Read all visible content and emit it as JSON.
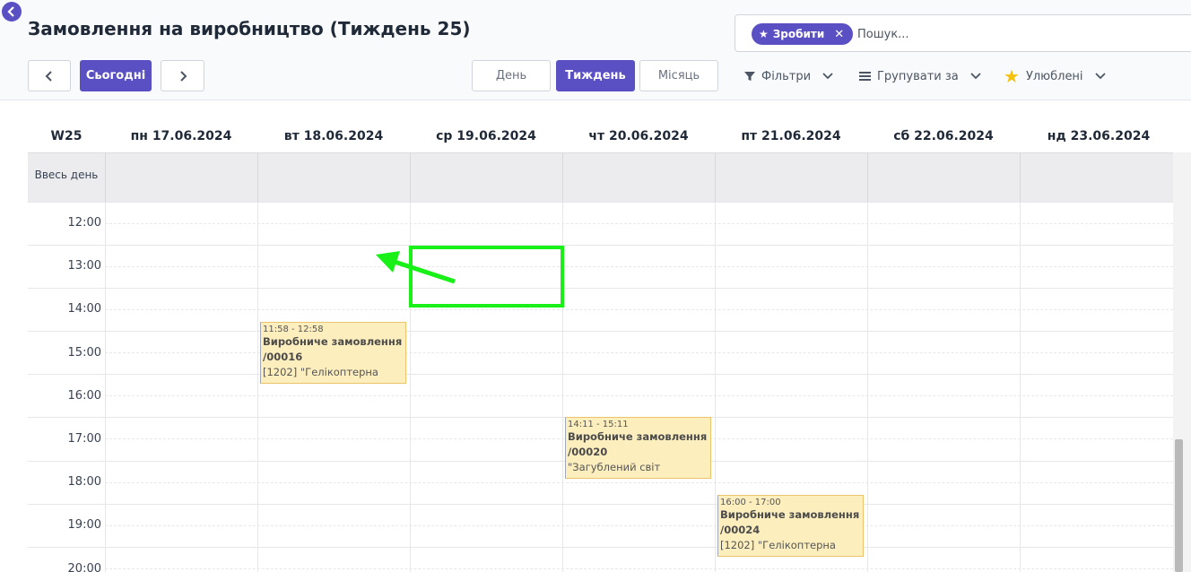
{
  "header": {
    "title": "Замовлення на виробництво (Тиждень 25)"
  },
  "search": {
    "facet_label": "Зробити",
    "placeholder": "Пошук..."
  },
  "nav": {
    "prev_symbol": "<",
    "today_label": "Сьогодні",
    "next_symbol": ">"
  },
  "scale": {
    "day_label": "День",
    "week_label": "Тиждень",
    "month_label": "Місяць",
    "active": "Тиждень"
  },
  "filters": {
    "filters_label": "Фільтри",
    "groupby_label": "Групувати за",
    "favorites_label": "Улюблені"
  },
  "calendar": {
    "week_label": "W25",
    "days": [
      "пн 17.06.2024",
      "вт 18.06.2024",
      "ср 19.06.2024",
      "чт 20.06.2024",
      "пт 21.06.2024",
      "сб 22.06.2024",
      "нд 23.06.2024"
    ],
    "all_day_label": "Ввесь день",
    "hours": [
      "12:00",
      "13:00",
      "14:00",
      "15:00",
      "16:00",
      "17:00",
      "18:00",
      "19:00",
      "20:00"
    ],
    "events": [
      {
        "time": "11:58 - 12:58",
        "title": "Виробниче замовлення",
        "number": "/00016",
        "subtitle": "[1202] \"Гелікоптерна"
      },
      {
        "time": "14:11 - 15:11",
        "title": "Виробниче замовлення",
        "number": "/00020",
        "subtitle": "\"Загублений світ"
      },
      {
        "time": "16:00 - 17:00",
        "title": "Виробниче замовлення",
        "number": "/00024",
        "subtitle": "[1202] \"Гелікоптерна"
      }
    ]
  },
  "colors": {
    "brand": "#5b4fc4",
    "event_bg": "#fdeebd",
    "annotation": "#18f018"
  }
}
